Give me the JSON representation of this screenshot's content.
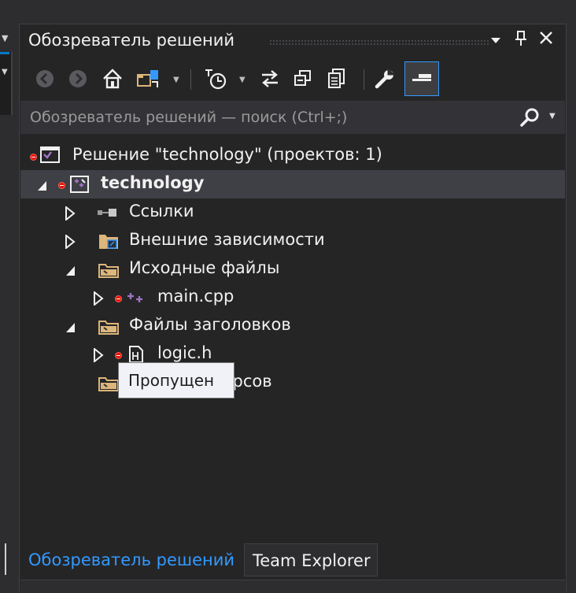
{
  "window": {
    "title": "Обозреватель решений"
  },
  "toolbar": {
    "buttons": [
      {
        "name": "back",
        "icon": "back-arrow-icon"
      },
      {
        "name": "forward",
        "icon": "forward-arrow-icon"
      },
      {
        "name": "home",
        "icon": "home-icon"
      },
      {
        "name": "switch-views",
        "icon": "switch-views-icon"
      },
      {
        "name": "pending-changes",
        "icon": "pending-changes-icon"
      },
      {
        "name": "sync",
        "icon": "sync-icon"
      },
      {
        "name": "collapse-all",
        "icon": "collapse-all-icon"
      },
      {
        "name": "show-all-files",
        "icon": "show-all-files-icon"
      },
      {
        "name": "properties",
        "icon": "wrench-icon"
      },
      {
        "name": "preview",
        "icon": "preview-icon"
      }
    ]
  },
  "search": {
    "placeholder": "Обозреватель решений — поиск (Ctrl+;)"
  },
  "tree": {
    "solution": "Решение \"technology\"  (проектов: 1)",
    "project": "technology",
    "items": [
      {
        "label": "Ссылки"
      },
      {
        "label": "Внешние зависимости"
      },
      {
        "label": "Исходные файлы"
      },
      {
        "label": "main.cpp"
      },
      {
        "label": "Файлы заголовков"
      },
      {
        "label": "logic.h"
      },
      {
        "label": "Файлы ресурсов"
      }
    ]
  },
  "tooltip": {
    "text": "Пропущен"
  },
  "tabs": [
    {
      "label": "Обозреватель решений",
      "active": true
    },
    {
      "label": "Team Explorer",
      "active": false
    }
  ],
  "colors": {
    "accent": "#3399ff",
    "background": "#252526",
    "error": "#e51400",
    "folder": "#dcb67a",
    "cpp": "#a074c4"
  }
}
